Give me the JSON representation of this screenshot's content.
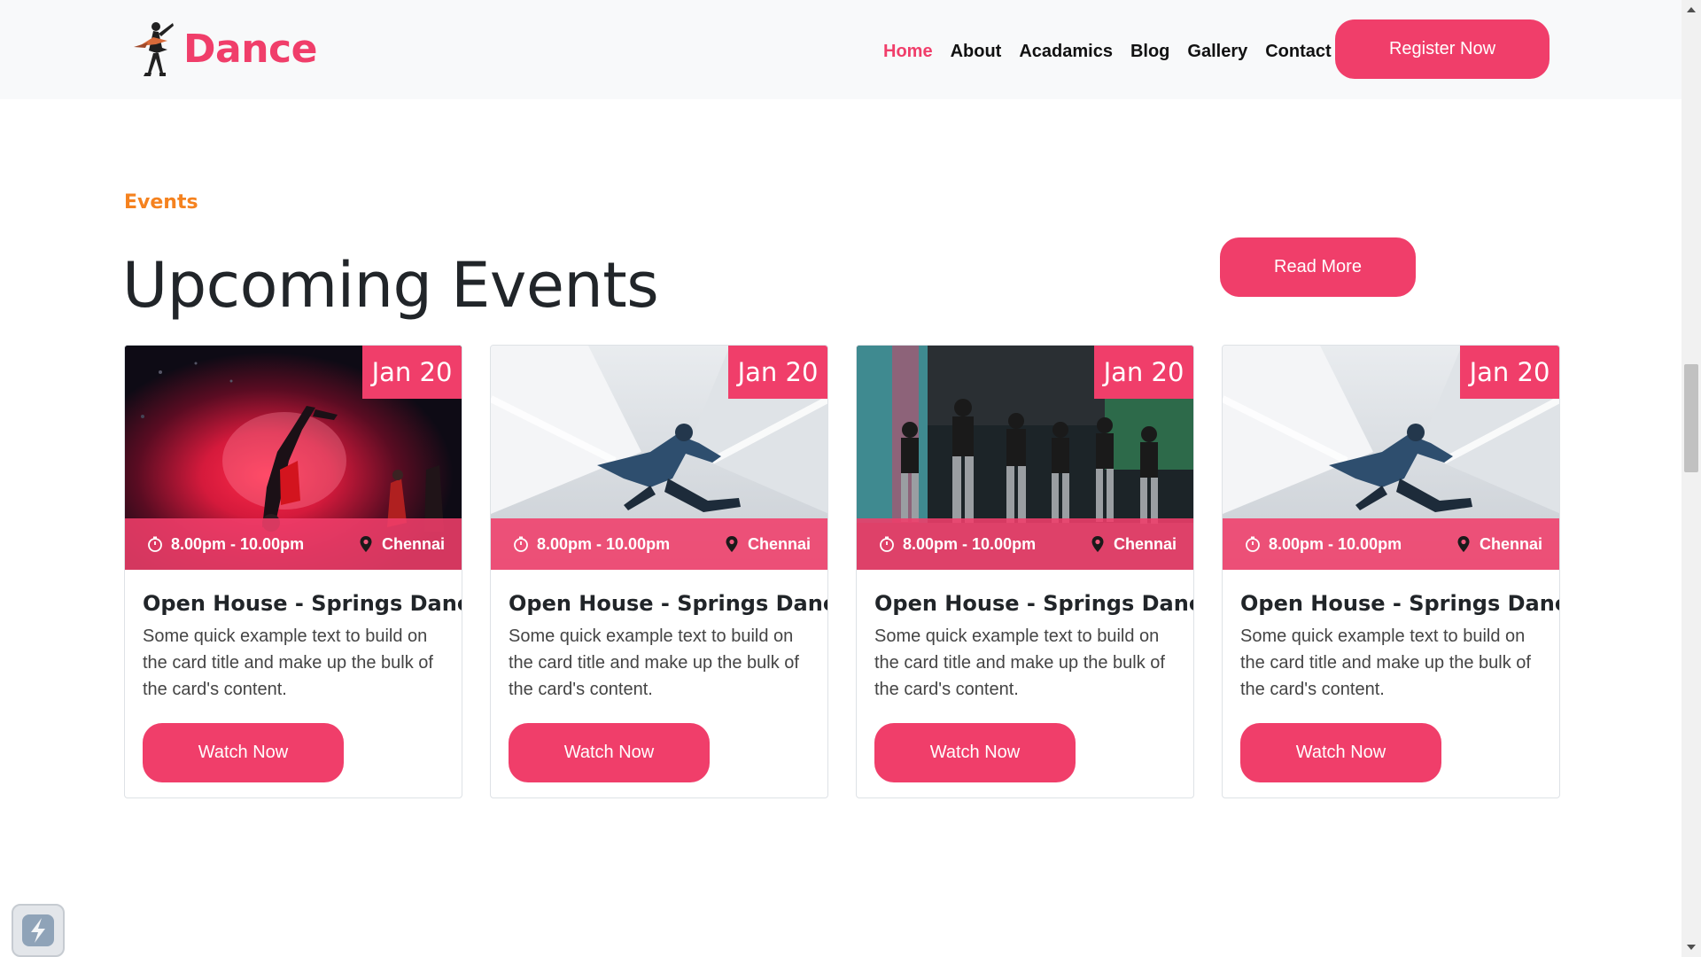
{
  "brand": {
    "name": "Dance"
  },
  "nav": {
    "links": [
      "Home",
      "About",
      "Acadamics",
      "Blog",
      "Gallery",
      "Contact"
    ],
    "active": "Home",
    "cta": "Register Now"
  },
  "section": {
    "eyebrow": "Events",
    "title": "Upcoming Events",
    "read_more": "Read More"
  },
  "cards": [
    {
      "date": "Jan 20",
      "time": "8.00pm - 10.00pm",
      "location": "Chennai",
      "title": "Open House - Springs Dance",
      "text": "Some quick example text to build on the card title and make up the bulk of the card's content.",
      "button": "Watch Now",
      "image": "breakdancer-red-smoke"
    },
    {
      "date": "Jan 20",
      "time": "8.00pm - 10.00pm",
      "location": "Chennai",
      "title": "Open House - Springs Dance",
      "text": "Some quick example text to build on the card title and make up the bulk of the card's content.",
      "button": "Watch Now",
      "image": "dancer-leaping-white-room"
    },
    {
      "date": "Jan 20",
      "time": "8.00pm - 10.00pm",
      "location": "Chennai",
      "title": "Open House - Springs Dance",
      "text": "Some quick example text to build on the card title and make up the bulk of the card's content.",
      "button": "Watch Now",
      "image": "dance-group-on-stage"
    },
    {
      "date": "Jan 20",
      "time": "8.00pm - 10.00pm",
      "location": "Chennai",
      "title": "Open House - Springs Dance",
      "text": "Some quick example text to build on the card title and make up the bulk of the card's content.",
      "button": "Watch Now",
      "image": "dancer-leaping-white-room"
    }
  ],
  "colors": {
    "brand": "#f03e6a",
    "eyebrow": "#f5821f",
    "navbar_bg": "#f8f9fa",
    "text": "#212529"
  },
  "icons": {
    "time": "stopwatch-icon",
    "location": "map-pin-icon",
    "widget": "lightning-app-icon"
  }
}
